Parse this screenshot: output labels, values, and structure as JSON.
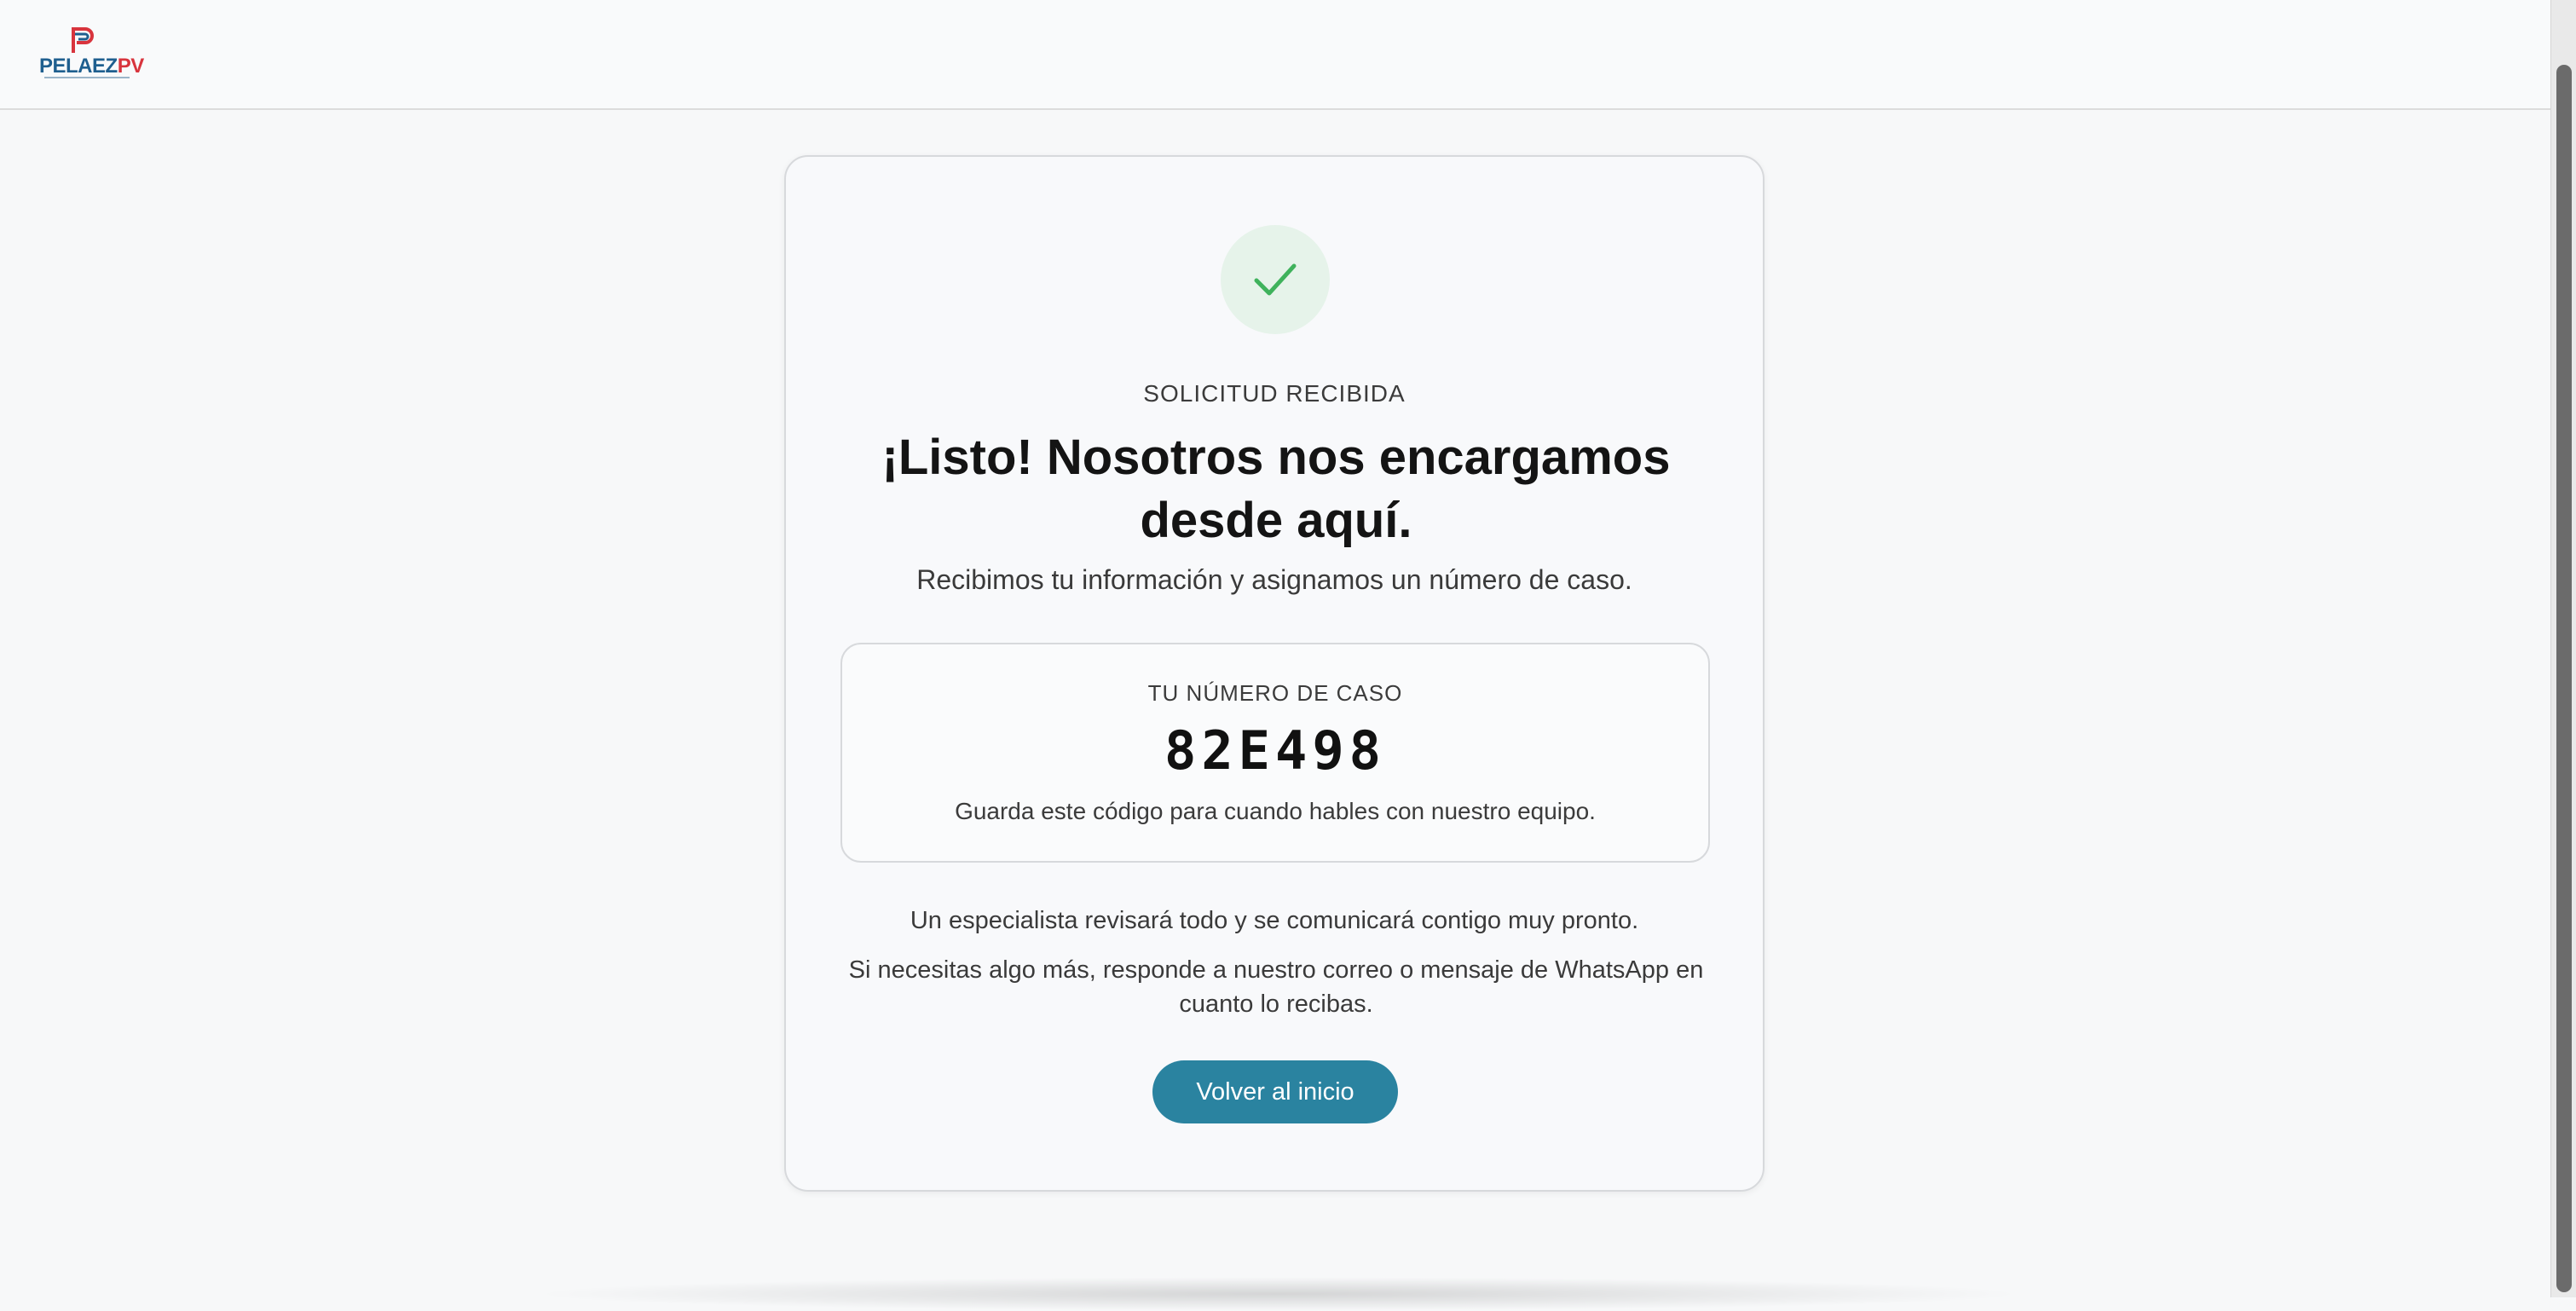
{
  "header": {
    "logo": {
      "brand_primary": "PELAEZ",
      "brand_secondary": "PV",
      "colors": {
        "primary": "#1f5f8f",
        "secondary": "#d8343d"
      }
    }
  },
  "confirmation": {
    "icon": "check-icon",
    "eyebrow": "SOLICITUD RECIBIDA",
    "title": "¡Listo! Nosotros nos encargamos desde aquí.",
    "subtitle": "Recibimos tu información y asignamos un número de caso.",
    "case": {
      "label": "TU NÚMERO DE CASO",
      "number": "82E498",
      "hint": "Guarda este código para cuando hables con nuestro equipo."
    },
    "info_line_1": "Un especialista revisará todo y se comunicará contigo muy pronto.",
    "info_line_2": "Si necesitas algo más, responde a nuestro correo o mensaje de WhatsApp en cuanto lo recibas.",
    "button_label": "Volver al inicio"
  },
  "colors": {
    "accent": "#2a83a0",
    "success": "#3fb25c",
    "success_bg": "#e6f3ea"
  }
}
